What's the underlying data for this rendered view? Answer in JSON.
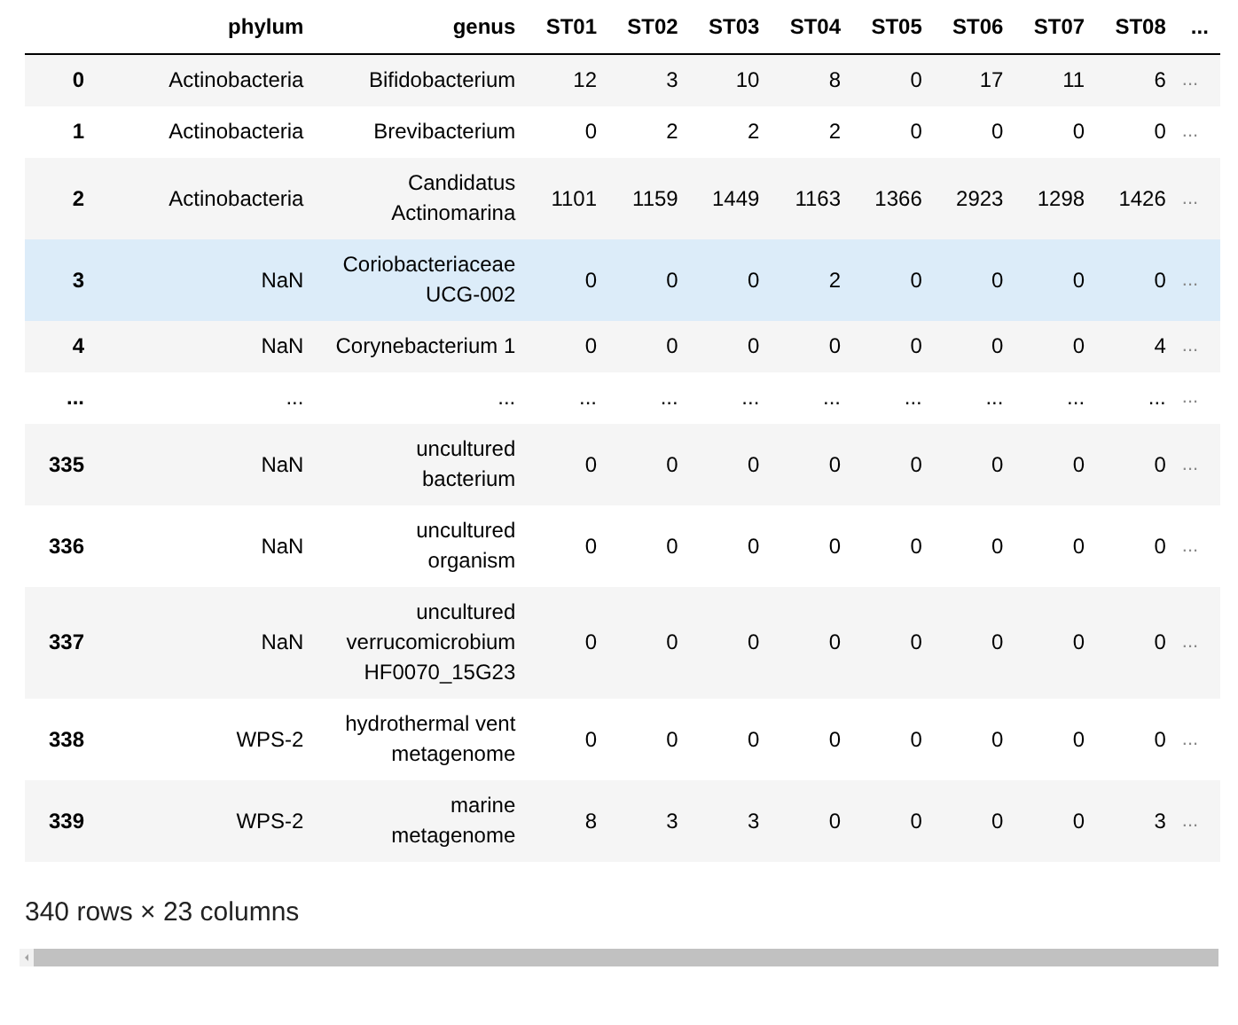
{
  "table": {
    "columns": [
      "phylum",
      "genus",
      "ST01",
      "ST02",
      "ST03",
      "ST04",
      "ST05",
      "ST06",
      "ST07",
      "ST08",
      "..."
    ],
    "rows": [
      {
        "index": "0",
        "phylum": "Actinobacteria",
        "genus": "Bifidobacterium",
        "values": [
          "12",
          "3",
          "10",
          "8",
          "0",
          "17",
          "11",
          "6",
          "..."
        ],
        "selected": false
      },
      {
        "index": "1",
        "phylum": "Actinobacteria",
        "genus": "Brevibacterium",
        "values": [
          "0",
          "2",
          "2",
          "2",
          "0",
          "0",
          "0",
          "0",
          "..."
        ],
        "selected": false
      },
      {
        "index": "2",
        "phylum": "Actinobacteria",
        "genus": "Candidatus Actinomarina",
        "values": [
          "1101",
          "1159",
          "1449",
          "1163",
          "1366",
          "2923",
          "1298",
          "1426",
          "..."
        ],
        "selected": false
      },
      {
        "index": "3",
        "phylum": "NaN",
        "genus": "Coriobacteriaceae UCG-002",
        "values": [
          "0",
          "0",
          "0",
          "2",
          "0",
          "0",
          "0",
          "0",
          "..."
        ],
        "selected": true
      },
      {
        "index": "4",
        "phylum": "NaN",
        "genus": "Corynebacterium 1",
        "values": [
          "0",
          "0",
          "0",
          "0",
          "0",
          "0",
          "0",
          "4",
          "..."
        ],
        "selected": false
      },
      {
        "index": "...",
        "phylum": "...",
        "genus": "...",
        "values": [
          "...",
          "...",
          "...",
          "...",
          "...",
          "...",
          "...",
          "...",
          "..."
        ],
        "selected": false
      },
      {
        "index": "335",
        "phylum": "NaN",
        "genus": "uncultured bacterium",
        "values": [
          "0",
          "0",
          "0",
          "0",
          "0",
          "0",
          "0",
          "0",
          "..."
        ],
        "selected": false
      },
      {
        "index": "336",
        "phylum": "NaN",
        "genus": "uncultured organism",
        "values": [
          "0",
          "0",
          "0",
          "0",
          "0",
          "0",
          "0",
          "0",
          "..."
        ],
        "selected": false
      },
      {
        "index": "337",
        "phylum": "NaN",
        "genus": "uncultured verrucomicrobium HF0070_15G23",
        "values": [
          "0",
          "0",
          "0",
          "0",
          "0",
          "0",
          "0",
          "0",
          "..."
        ],
        "selected": false
      },
      {
        "index": "338",
        "phylum": "WPS-2",
        "genus": "hydrothermal vent metagenome",
        "values": [
          "0",
          "0",
          "0",
          "0",
          "0",
          "0",
          "0",
          "0",
          "..."
        ],
        "selected": false
      },
      {
        "index": "339",
        "phylum": "WPS-2",
        "genus": "marine metagenome",
        "values": [
          "8",
          "3",
          "3",
          "0",
          "0",
          "0",
          "0",
          "3",
          "..."
        ],
        "selected": false
      }
    ]
  },
  "footer": "340 rows × 23 columns"
}
